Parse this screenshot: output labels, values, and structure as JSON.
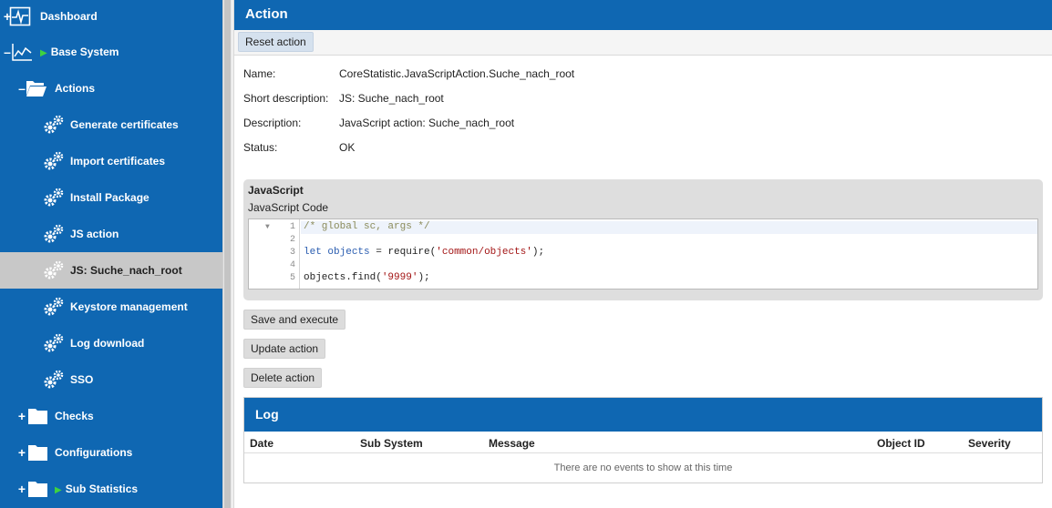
{
  "sidebar": {
    "items": [
      {
        "label": "Dashboard",
        "toggle": "+",
        "icon": "dashboard-icon",
        "play": false
      },
      {
        "label": "Base System",
        "toggle": "–",
        "icon": "line-chart-icon",
        "play": true
      },
      {
        "label": "Actions",
        "toggle": "–",
        "icon": "folder-open-icon",
        "play": false
      },
      {
        "label": "Generate certificates",
        "icon": "gears-icon"
      },
      {
        "label": "Import certificates",
        "icon": "gears-icon"
      },
      {
        "label": "Install Package",
        "icon": "gears-icon"
      },
      {
        "label": "JS action",
        "icon": "gears-icon"
      },
      {
        "label": "JS: Suche_nach_root",
        "icon": "gears-icon",
        "selected": true
      },
      {
        "label": "Keystore management",
        "icon": "gears-icon"
      },
      {
        "label": "Log download",
        "icon": "gears-icon"
      },
      {
        "label": "SSO",
        "icon": "gears-icon"
      },
      {
        "label": "Checks",
        "toggle": "+",
        "icon": "folder-icon",
        "play": false
      },
      {
        "label": "Configurations",
        "toggle": "+",
        "icon": "folder-icon",
        "play": false
      },
      {
        "label": "Sub Statistics",
        "toggle": "+",
        "icon": "folder-icon",
        "play": true
      }
    ]
  },
  "action": {
    "title": "Action",
    "reset_label": "Reset action",
    "fields": {
      "name_label": "Name:",
      "name_value": "CoreStatistic.JavaScriptAction.Suche_nach_root",
      "short_label": "Short description:",
      "short_value": "JS: Suche_nach_root",
      "desc_label": "Description:",
      "desc_value": "JavaScript action: Suche_nach_root",
      "status_label": "Status:",
      "status_value": "OK"
    },
    "javascript": {
      "title": "JavaScript",
      "subtitle": "JavaScript Code",
      "line_numbers": [
        "1",
        "2",
        "3",
        "4",
        "5"
      ]
    },
    "buttons": {
      "save_execute": "Save and execute",
      "update": "Update action",
      "delete": "Delete action"
    }
  },
  "log": {
    "title": "Log",
    "columns": [
      "Date",
      "Sub System",
      "Message",
      "Object ID",
      "Severity"
    ],
    "empty_text": "There are no events to show at this time"
  },
  "colors": {
    "brand_blue": "#0f67b2",
    "selected_item": "#c8c8c8",
    "play_green": "#3fd23f"
  }
}
